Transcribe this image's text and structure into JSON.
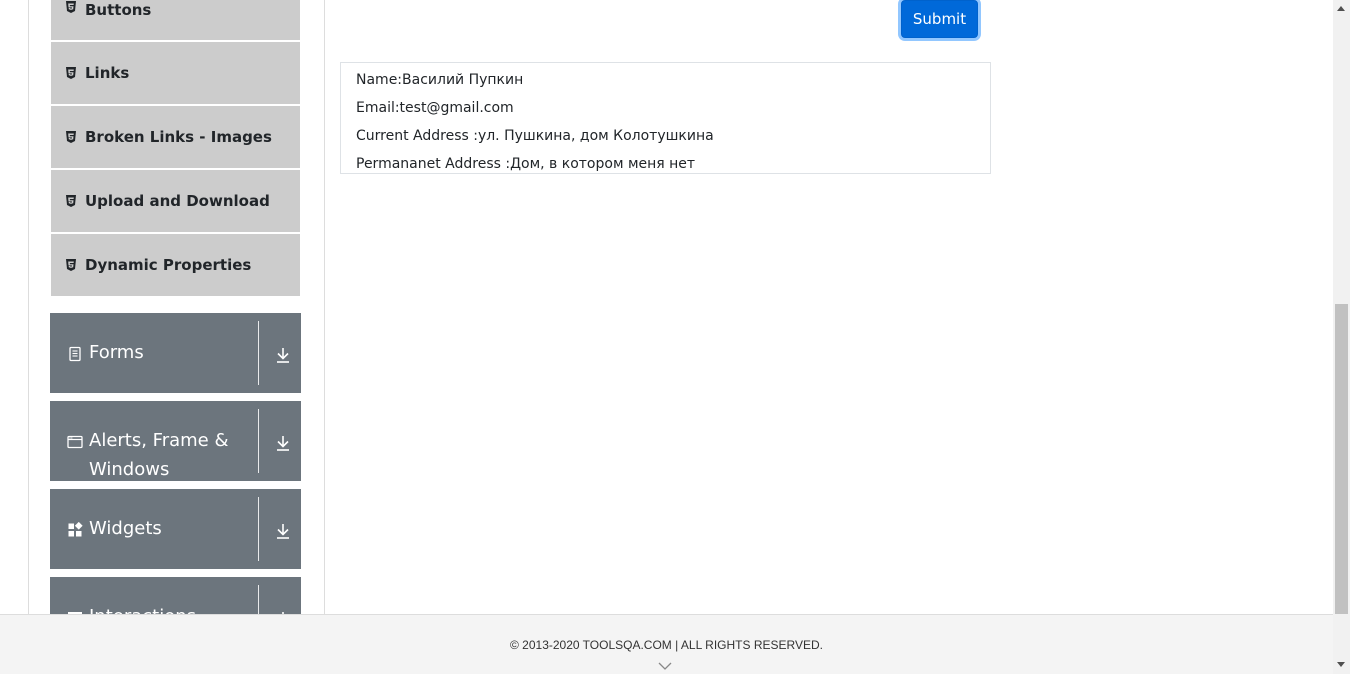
{
  "sidebar": {
    "element_items": [
      {
        "label": "Buttons",
        "icon": "html5-icon"
      },
      {
        "label": "Links",
        "icon": "html5-icon"
      },
      {
        "label": "Broken Links - Images",
        "icon": "html5-icon"
      },
      {
        "label": "Upload and Download",
        "icon": "html5-icon"
      },
      {
        "label": "Dynamic Properties",
        "icon": "html5-icon"
      }
    ],
    "groups": [
      {
        "title": "Forms",
        "icon": "document-icon",
        "toggle_icon": "download-arrow-icon"
      },
      {
        "title_line1": "Alerts, Frame &",
        "title_line2": "Windows",
        "icon": "browser-window-icon",
        "toggle_icon": "download-arrow-icon"
      },
      {
        "title": "Widgets",
        "icon": "widgets-icon",
        "toggle_icon": "download-arrow-icon"
      },
      {
        "title": "Interactions",
        "icon": "interactions-icon",
        "toggle_icon": "download-arrow-icon"
      }
    ]
  },
  "form": {
    "submit_label": "Submit"
  },
  "output": {
    "name": "Name:Василий Пупкин",
    "email": "Email:test@gmail.com",
    "current_address": "Current Address :ул. Пушкина, дом Колотушкина",
    "permanent_address": "Permananet Address :Дом, в котором меня нет"
  },
  "footer": {
    "copyright": "© 2013-2020 TOOLSQA.COM | ALL RIGHTS RESERVED."
  },
  "colors": {
    "group_bg": "#6c757d",
    "item_bg": "#cccccc",
    "primary": "#0069d9",
    "footer_bg": "#f4f4f4"
  }
}
